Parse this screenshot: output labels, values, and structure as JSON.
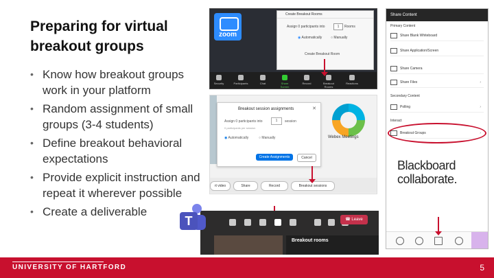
{
  "slide": {
    "title": "Preparing for virtual breakout groups",
    "bullets": [
      "Know how breakout groups work in your platform",
      "Random assignment of small groups (3-4 students)",
      "Define breakout behavioral expectations",
      "Provide explicit instruction and repeat it wherever possible",
      "Create a deliverable"
    ],
    "footer": {
      "university": "UNIVERSITY OF HARTFORD",
      "page_number": "5"
    }
  },
  "zoom": {
    "logo_text": "zoom",
    "dialog_title": "Create Breakout Rooms",
    "assign_text": "Assign 0 participants into",
    "rooms_count": "1",
    "rooms_label": "Rooms",
    "option_auto": "Automatically",
    "option_manual": "Manually",
    "create_button": "Create Breakout Room",
    "toolbar": [
      "Security",
      "Participants",
      "Chat",
      "Share Screen",
      "Record",
      "Breakout Rooms",
      "Reactions"
    ]
  },
  "webex": {
    "dialog_title": "Breakout session assignments",
    "assign_text": "Assign 0 participants into",
    "sessions_count": "1",
    "sessions_label": "session",
    "per_session": "0 participants per session",
    "option_auto": "Automatically",
    "option_manual": "Manually",
    "create_button": "Create Assignments",
    "cancel_button": "Cancel",
    "logo_label": "Webex Meetings",
    "toolbar": [
      "rt video",
      "Share",
      "Record",
      "Breakout sessions"
    ]
  },
  "teams": {
    "leave_label": "Leave",
    "panel_title": "Breakout rooms"
  },
  "blackboard": {
    "header": "Share Content",
    "primary_label": "Primary Content",
    "primary_items": [
      "Share Blank Whiteboard",
      "Share Application/Screen",
      "Share Camera",
      "Share Files"
    ],
    "secondary_label": "Secondary Content",
    "secondary_items": [
      "Polling"
    ],
    "interact_label": "Interact",
    "interact_items": [
      "Breakout Groups"
    ],
    "logo_line1": "Blackboard",
    "logo_line2": "collaborate."
  },
  "colors": {
    "accent_red": "#c8102e",
    "zoom_blue": "#2d8cff",
    "teams_purple": "#4b53bc"
  }
}
